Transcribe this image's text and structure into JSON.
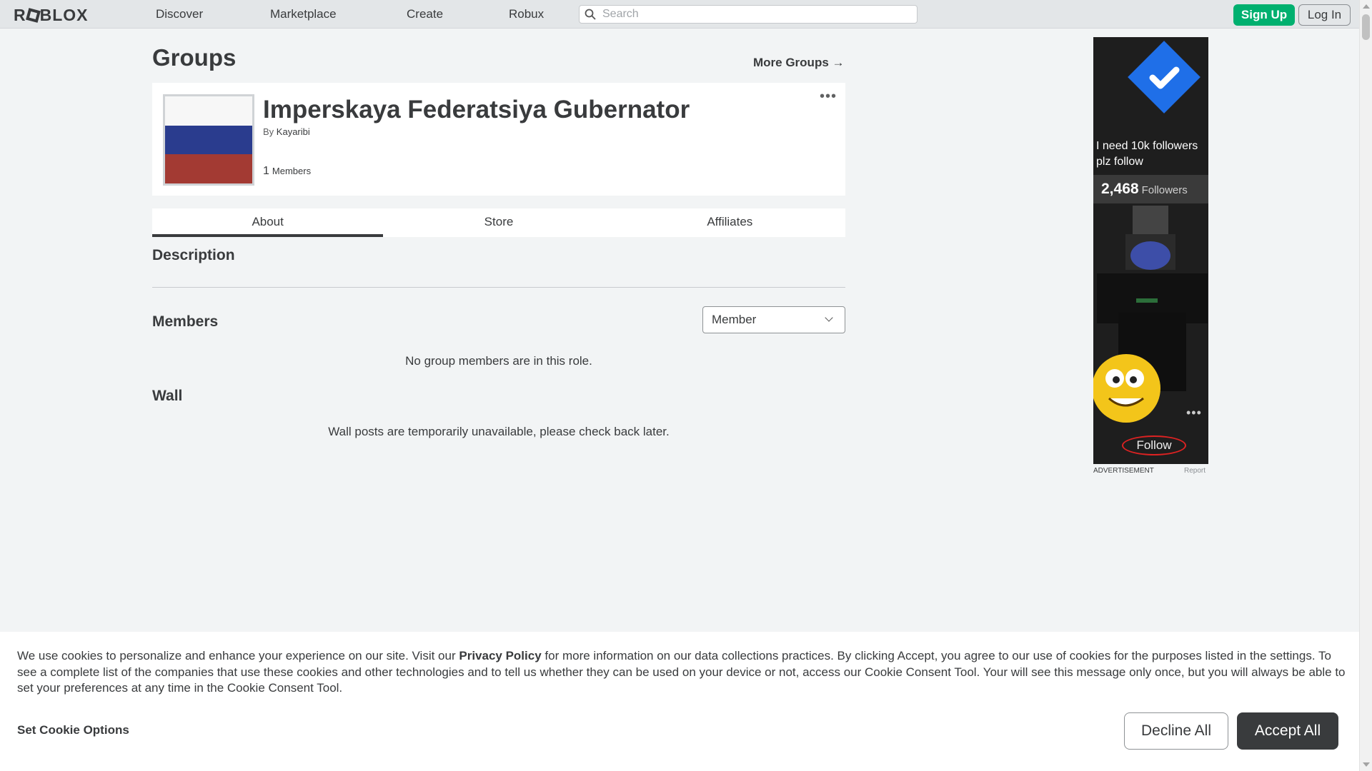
{
  "header": {
    "logo": "ROBLOX",
    "nav": [
      "Discover",
      "Marketplace",
      "Create",
      "Robux"
    ],
    "search_placeholder": "Search",
    "sign_up": "Sign Up",
    "log_in": "Log In"
  },
  "page": {
    "title": "Groups",
    "more_groups": "More Groups →"
  },
  "group": {
    "name": "Imperskaya Federatsiya Gubernator",
    "by_prefix": "By",
    "owner": "Kayaribi",
    "member_count": "1",
    "members_label": "Members",
    "more_icon": "•••"
  },
  "tabs": [
    "About",
    "Store",
    "Affiliates"
  ],
  "about": {
    "description_heading": "Description",
    "members_heading": "Members",
    "role_selected": "Member",
    "members_empty": "No group members are in this role.",
    "wall_heading": "Wall",
    "wall_message": "Wall posts are temporarily unavailable, please check back later."
  },
  "ad": {
    "text": "I need 10k followers plz follow",
    "followers_count": "2,468",
    "followers_label": "Followers",
    "more_icon": "•••",
    "follow": "Follow",
    "label": "ADVERTISEMENT",
    "report": "Report"
  },
  "cookie": {
    "text_before": "We use cookies to personalize and enhance your experience on our site. Visit our ",
    "privacy_link": "Privacy Policy",
    "text_after": " for more information on our data collections practices. By clicking Accept, you agree to our use of cookies for the purposes listed in the settings. To see a complete list of the companies that use these cookies and other technologies and to tell us whether they can be used on your device or not, access our Cookie Consent Tool. Your will see this message only once, but you will always be able to set your preferences at any time in the Cookie Consent Tool.",
    "set_options": "Set Cookie Options",
    "decline": "Decline All",
    "accept": "Accept All"
  },
  "colors": {
    "brand_green": "#00b06f",
    "text": "#393b3d",
    "background": "#f2f4f5",
    "flag_white": "#f7f7f7",
    "flag_blue": "#2a3c8e",
    "flag_red": "#a33a33"
  }
}
